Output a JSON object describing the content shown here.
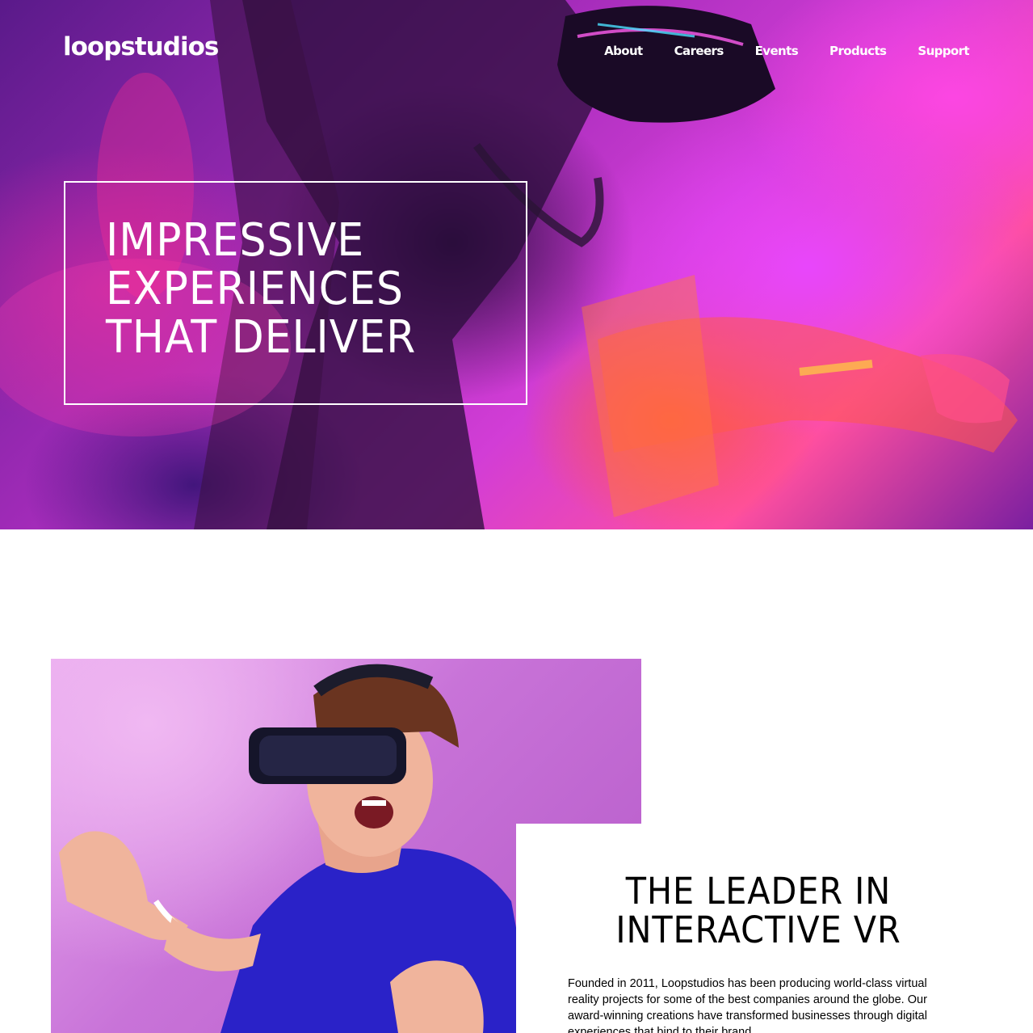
{
  "header": {
    "logo": "loopstudios",
    "nav": [
      "About",
      "Careers",
      "Events",
      "Products",
      "Support"
    ]
  },
  "hero": {
    "title_lines": [
      "IMPRESSIVE",
      "EXPERIENCES",
      "THAT DELIVER"
    ]
  },
  "feature": {
    "title_lines": [
      "THE LEADER IN",
      "INTERACTIVE VR"
    ],
    "body": "Founded in 2011, Loopstudios has been producing world-class virtual reality projects for some of the best companies around the globe. Our award-winning creations have transformed businesses through digital experiences that bind to their brand."
  },
  "colors": {
    "hero_magenta": "#d23dd6",
    "hero_pink": "#ff4fa0",
    "hero_violet": "#5a1a8a",
    "feature_bg": "#c873d8",
    "shirt_blue": "#2a22c8",
    "text_dark": "#000000",
    "text_light": "#ffffff"
  },
  "images": {
    "hero": "woman-with-vr-headset-neon-photo",
    "feature": "man-with-vr-headset-photo"
  }
}
